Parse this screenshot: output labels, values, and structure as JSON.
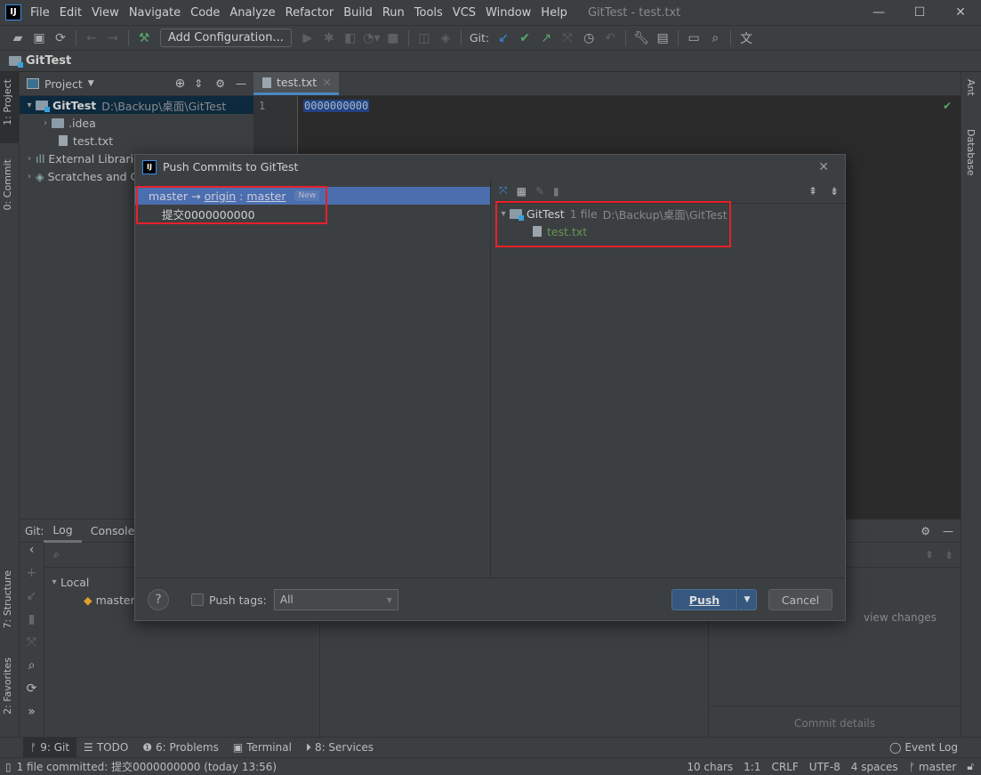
{
  "window": {
    "title": "GitTest - test.txt",
    "logo": "IJ"
  },
  "menu": [
    "File",
    "Edit",
    "View",
    "Navigate",
    "Code",
    "Analyze",
    "Refactor",
    "Build",
    "Run",
    "Tools",
    "VCS",
    "Window",
    "Help"
  ],
  "toolbar": {
    "add_configuration": "Add Configuration...",
    "git_label": "Git:"
  },
  "navbar": {
    "project": "GitTest"
  },
  "left_strip": {
    "project": "1: Project",
    "commit": "0: Commit",
    "structure": "7: Structure",
    "favorites": "2: Favorites"
  },
  "right_strip": {
    "ant": "Ant",
    "database": "Database"
  },
  "project_panel": {
    "title": "Project",
    "root": "GitTest",
    "root_path": "D:\\Backup\\桌面\\GitTest",
    "items": [
      ".idea",
      "test.txt",
      "External Libraries",
      "Scratches and Consoles"
    ]
  },
  "editor": {
    "tab": "test.txt",
    "line_number": "1",
    "content": "0000000000"
  },
  "git_panel": {
    "label": "Git:",
    "tabs": [
      "Log",
      "Console"
    ],
    "local": "Local",
    "branch": "master",
    "view_changes": "view changes",
    "commit_details": "Commit details"
  },
  "dialog": {
    "title": "Push Commits to GitTest",
    "branch_local": "master",
    "arrow": "→",
    "remote": "origin",
    "remote_branch": "master",
    "badge": "New",
    "commit": "提交0000000000",
    "repo": "GitTest",
    "file_count": "1 file",
    "repo_path": "D:\\Backup\\桌面\\GitTest",
    "file": "test.txt",
    "help": "?",
    "push_tags": "Push tags:",
    "tags_select": "All",
    "push": "Push",
    "cancel": "Cancel"
  },
  "bottom_tools": [
    "9: Git",
    "TODO",
    "6: Problems",
    "Terminal",
    "8: Services"
  ],
  "event_log": "Event Log",
  "status": {
    "message": "1 file committed: 提交0000000000 (today 13:56)",
    "chars": "10 chars",
    "position": "1:1",
    "line_sep": "CRLF",
    "encoding": "UTF-8",
    "indent": "4 spaces",
    "branch": "master"
  },
  "colors": {
    "accent": "#4b6eaf",
    "highlight": "#e8202a",
    "file_added": "#629755",
    "push_button": "#365880"
  }
}
